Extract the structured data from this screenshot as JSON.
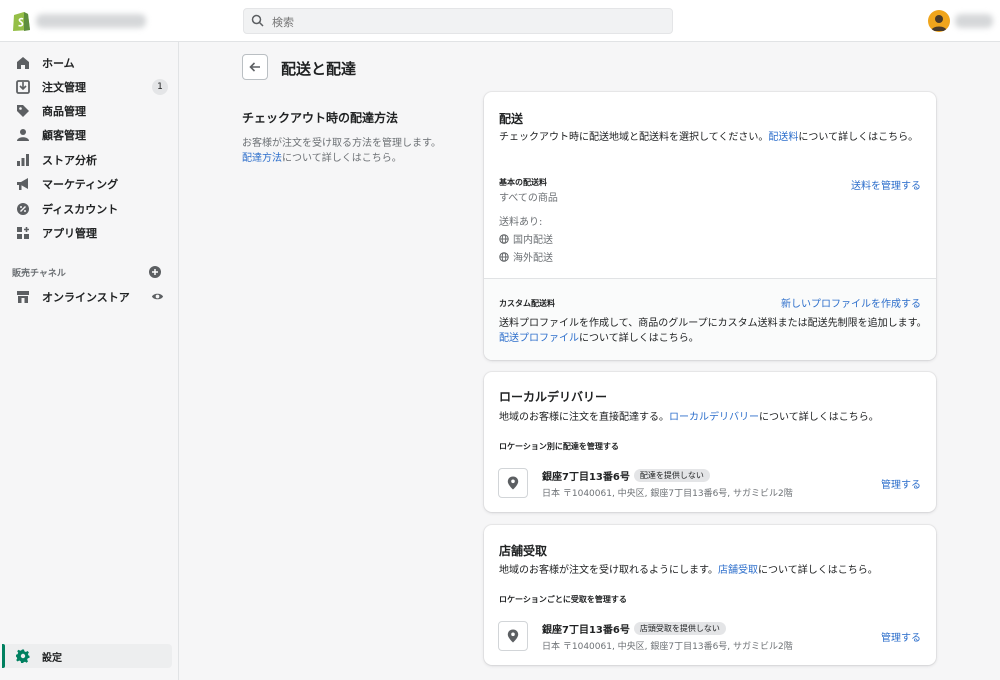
{
  "topbar": {
    "search_placeholder": "検索"
  },
  "sidebar": {
    "items": [
      {
        "label": "ホーム",
        "icon": "home-icon"
      },
      {
        "label": "注文管理",
        "icon": "orders-icon",
        "badge": "1"
      },
      {
        "label": "商品管理",
        "icon": "tag-icon"
      },
      {
        "label": "顧客管理",
        "icon": "person-icon"
      },
      {
        "label": "ストア分析",
        "icon": "bar-chart-icon"
      },
      {
        "label": "マーケティング",
        "icon": "megaphone-icon"
      },
      {
        "label": "ディスカウント",
        "icon": "discount-icon"
      },
      {
        "label": "アプリ管理",
        "icon": "apps-icon"
      }
    ],
    "channels_title": "販売チャネル",
    "online_store_label": "オンラインストア",
    "settings_label": "設定"
  },
  "page": {
    "title": "配送と配達",
    "aside_title": "チェックアウト時の配達方法",
    "aside_desc_pre": "お客様が注文を受け取る方法を管理します。",
    "aside_link": "配達方法",
    "aside_desc_post": "について詳しくはこちら。"
  },
  "shipping": {
    "title": "配送",
    "desc_pre": "チェックアウト時に配送地域と配送料を選択してください。",
    "desc_link": "配送料",
    "desc_post": "について詳しくはこちら。",
    "general_head": "基本の配送料",
    "general_sub": "すべての商品",
    "manage_link": "送料を管理する",
    "rates_label": "送料あり:",
    "zones": [
      "国内配送",
      "海外配送"
    ],
    "custom_head": "カスタム配送料",
    "new_profile_link": "新しいプロファイルを作成する",
    "custom_desc_pre": "送料プロファイルを作成して、商品のグループにカスタム送料または配送先制限を追加します。",
    "custom_link": "配送プロファイル",
    "custom_desc_post": "について詳しくはこちら。"
  },
  "local_delivery": {
    "title": "ローカルデリバリー",
    "desc_pre": "地域のお客様に注文を直接配達する。",
    "desc_link": "ローカルデリバリー",
    "desc_post": "について詳しくはこちら。",
    "section_head": "ロケーション別に配達を管理する",
    "location_name": "銀座7丁目13番6号",
    "status": "配達を提供しない",
    "address": "日本 〒1040061, 中央区, 銀座7丁目13番6号, サガミビル2階",
    "manage_link": "管理する"
  },
  "pickup": {
    "title": "店舗受取",
    "desc_pre": "地域のお客様が注文を受け取れるようにします。",
    "desc_link": "店舗受取",
    "desc_post": "について詳しくはこちら。",
    "section_head": "ロケーションごとに受取を管理する",
    "location_name": "銀座7丁目13番6号",
    "status": "店頭受取を提供しない",
    "address": "日本 〒1040061, 中央区, 銀座7丁目13番6号, サガミビル2階",
    "manage_link": "管理する"
  },
  "colors": {
    "brand": "#008060",
    "link": "#2c6ecb",
    "avatar": "#f0a51c"
  }
}
